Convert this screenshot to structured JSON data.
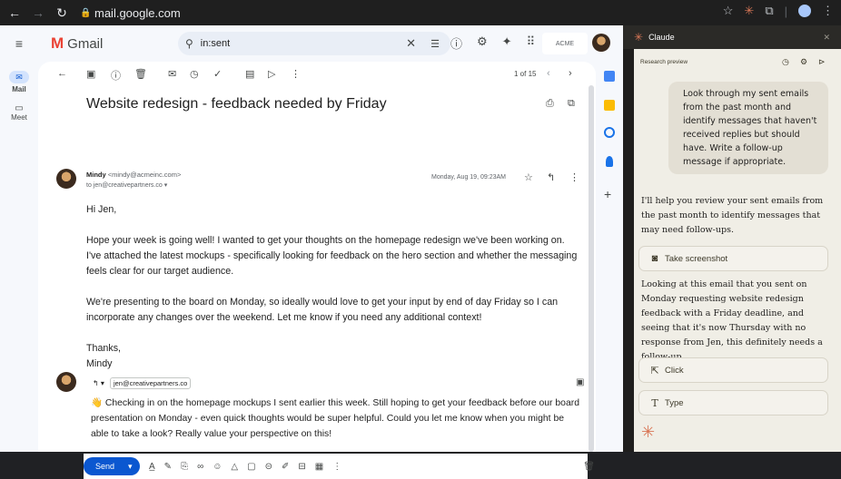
{
  "browser": {
    "url": "mail.google.com"
  },
  "gmail": {
    "app_name": "Gmail",
    "search_query": "in:sent",
    "org_badge": "ACME",
    "rail": [
      {
        "label": "Mail"
      },
      {
        "label": "Meet"
      }
    ],
    "pagination": "1 of 15",
    "subject": "Website redesign - feedback needed by Friday",
    "sender_name": "Mindy",
    "sender_email": "<mindy@acmeinc.com>",
    "to_line": "to jen@creativepartners.co",
    "date": "Monday, Aug 19, 09:23AM",
    "body": [
      "Hi Jen,",
      "Hope your week is going well! I wanted to get your thoughts on the homepage redesign we've been working on. I've attached the latest mockups - specifically looking for feedback on the hero section and whether the messaging feels clear for our target audience.",
      "We're presenting to the board on Monday, so ideally would love to get your input by end of day Friday so I can incorporate any changes over the weekend. Let me know if you need any additional context!",
      "Thanks,\nMindy"
    ],
    "reply_recipient": "jen@creativepartners.co",
    "reply_draft": "👋 Checking in on the homepage mockups I sent earlier this week. Still hoping to get your feedback before our board presentation on Monday - even quick thoughts would be super helpful. Could you let me know when you might be able to take a look? Really value your perspective on this!",
    "send_label": "Send"
  },
  "claude": {
    "title": "Claude",
    "badge": "Research preview",
    "user_message": "Look through my sent emails from the past month and identify messages that haven't received replies but should have. Write a follow-up message if appropriate.",
    "reply_1": "I'll help you review your sent emails from the past month to identify messages that may need follow-ups.",
    "tool_1": "Take screenshot",
    "reply_2": "Looking at this email that you sent on Monday requesting website redesign feedback with a Friday deadline, and seeing that it's now Thursday with no response from Jen, this definitely needs a follow-up.",
    "tool_2": "Click",
    "tool_3": "Type"
  }
}
